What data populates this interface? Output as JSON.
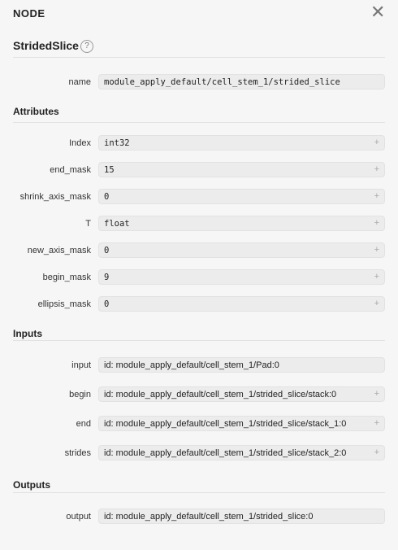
{
  "header": {
    "title": "NODE",
    "close_glyph": "✕"
  },
  "op": {
    "name": "StridedSlice",
    "help_glyph": "?"
  },
  "name_row": {
    "label": "name",
    "value": "module_apply_default/cell_stem_1/strided_slice"
  },
  "attributes": {
    "title": "Attributes",
    "items": [
      {
        "label": "Index",
        "value": "int32"
      },
      {
        "label": "end_mask",
        "value": "15"
      },
      {
        "label": "shrink_axis_mask",
        "value": "0"
      },
      {
        "label": "T",
        "value": "float"
      },
      {
        "label": "new_axis_mask",
        "value": "0"
      },
      {
        "label": "begin_mask",
        "value": "9"
      },
      {
        "label": "ellipsis_mask",
        "value": "0"
      }
    ]
  },
  "inputs": {
    "title": "Inputs",
    "items": [
      {
        "label": "input",
        "value": "id: module_apply_default/cell_stem_1/Pad:0"
      },
      {
        "label": "begin",
        "value": "id: module_apply_default/cell_stem_1/strided_slice/stack:0"
      },
      {
        "label": "end",
        "value": "id: module_apply_default/cell_stem_1/strided_slice/stack_1:0"
      },
      {
        "label": "strides",
        "value": "id: module_apply_default/cell_stem_1/strided_slice/stack_2:0"
      }
    ]
  },
  "outputs": {
    "title": "Outputs",
    "items": [
      {
        "label": "output",
        "value": "id: module_apply_default/cell_stem_1/strided_slice:0"
      }
    ]
  },
  "expand_glyph": "+",
  "icons": {
    "close": "close-icon",
    "help": "help-icon",
    "expand": "plus-icon"
  }
}
